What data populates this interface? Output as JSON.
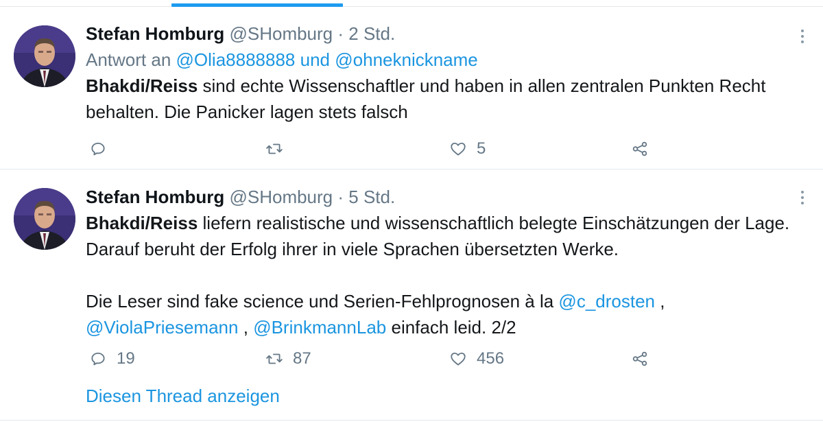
{
  "tweets": [
    {
      "name": "Stefan Homburg",
      "handle": "@SHomburg",
      "separator": "·",
      "time": "2 Std.",
      "reply_prefix": "Antwort an",
      "reply_user1": "@Olia8888888",
      "reply_and": "und",
      "reply_user2": "@ohneknickname",
      "bold": "Bhakdi/Reiss",
      "text": "sind echte Wissenschaftler und haben in allen zentralen Punkten Recht behalten. Die Panicker lagen stets falsch",
      "reply_count": "",
      "retweet_count": "",
      "like_count": "5"
    },
    {
      "name": "Stefan Homburg",
      "handle": "@SHomburg",
      "separator": "·",
      "time": "5 Std.",
      "bold": "Bhakdi/Reiss",
      "text1": "liefern realistische und wissenschaftlich belegte Einschätzungen der Lage. Darauf beruht der Erfolg ihrer in viele Sprachen übersetzten Werke.",
      "text2_pre": "Die Leser sind fake science und Serien-Fehlprognosen à la",
      "mention1": "@c_drosten",
      "comma1": ",",
      "mention2": "@ViolaPriesemann",
      "comma2": ",",
      "mention3": "@BrinkmannLab",
      "text2_post": "einfach leid. 2/2",
      "reply_count": "19",
      "retweet_count": "87",
      "like_count": "456"
    }
  ],
  "thread_link": "Diesen Thread anzeigen",
  "colors": {
    "accent": "#1b95e0",
    "muted": "#657786",
    "tab_indicator": "#1d9bf0"
  },
  "icons": [
    "reply-icon",
    "retweet-icon",
    "like-icon",
    "share-icon",
    "more-icon"
  ]
}
